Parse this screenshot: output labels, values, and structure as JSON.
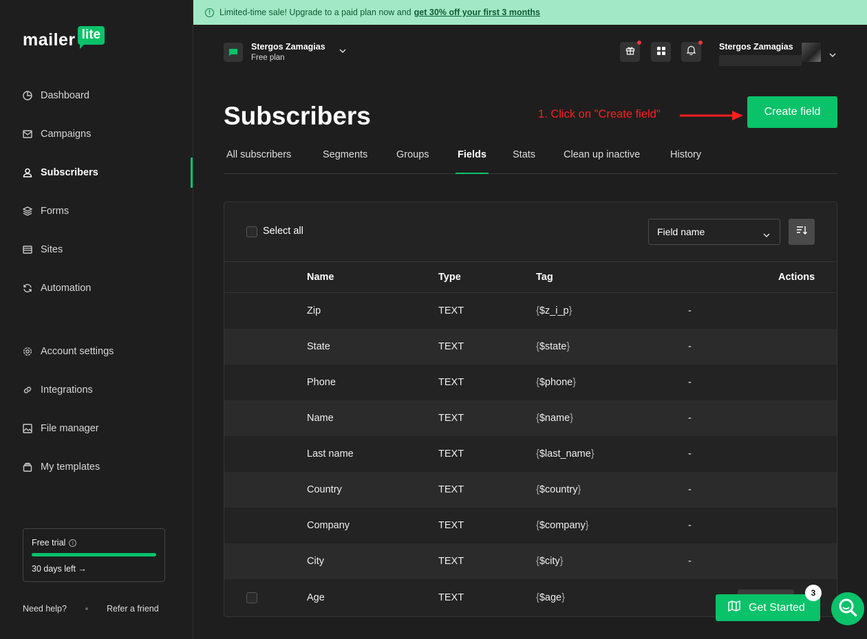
{
  "brand": {
    "word": "mailer",
    "badge": "lite",
    "accent": "#09c269"
  },
  "banner": {
    "text": "Limited-time sale! Upgrade to a paid plan now and",
    "link": "get 30% off your first 3 months"
  },
  "sidebar": {
    "items": [
      {
        "label": "Dashboard",
        "icon": "dashboard-icon"
      },
      {
        "label": "Campaigns",
        "icon": "mail-icon"
      },
      {
        "label": "Subscribers",
        "icon": "user-icon"
      },
      {
        "label": "Forms",
        "icon": "layers-icon"
      },
      {
        "label": "Sites",
        "icon": "browser-icon"
      },
      {
        "label": "Automation",
        "icon": "refresh-icon"
      },
      {
        "label": "Account settings",
        "icon": "gear-icon"
      },
      {
        "label": "Integrations",
        "icon": "link-icon"
      },
      {
        "label": "File manager",
        "icon": "image-icon"
      },
      {
        "label": "My templates",
        "icon": "template-icon"
      }
    ],
    "trial": {
      "label": "Free trial",
      "days": "30 days left →",
      "progress": 1.0
    },
    "footer": {
      "help": "Need help?",
      "refer": "Refer a friend"
    }
  },
  "header": {
    "account_name": "Stergos Zamagias",
    "account_plan": "Free plan",
    "user_name": "Stergos Zamagias"
  },
  "page": {
    "title": "Subscribers",
    "annotation": "1. Click on \"Create field\"",
    "create_button": "Create field"
  },
  "tabs": [
    {
      "label": "All subscribers"
    },
    {
      "label": "Segments"
    },
    {
      "label": "Groups"
    },
    {
      "label": "Fields",
      "active": true
    },
    {
      "label": "Stats"
    },
    {
      "label": "Clean up inactive"
    },
    {
      "label": "History"
    }
  ],
  "table": {
    "select_all": "Select all",
    "sort_select": "Field name",
    "headers": {
      "name": "Name",
      "type": "Type",
      "tag": "Tag",
      "actions": "Actions"
    },
    "rows": [
      {
        "name": "Zip",
        "type": "TEXT",
        "tag": "$z_i_p",
        "action": "-"
      },
      {
        "name": "State",
        "type": "TEXT",
        "tag": "$state",
        "action": "-"
      },
      {
        "name": "Phone",
        "type": "TEXT",
        "tag": "$phone",
        "action": "-"
      },
      {
        "name": "Name",
        "type": "TEXT",
        "tag": "$name",
        "action": "-"
      },
      {
        "name": "Last name",
        "type": "TEXT",
        "tag": "$last_name",
        "action": "-"
      },
      {
        "name": "Country",
        "type": "TEXT",
        "tag": "$country",
        "action": "-"
      },
      {
        "name": "Company",
        "type": "TEXT",
        "tag": "$company",
        "action": "-"
      },
      {
        "name": "City",
        "type": "TEXT",
        "tag": "$city",
        "action": "-"
      },
      {
        "name": "Age",
        "type": "TEXT",
        "tag": "$age",
        "action": ""
      }
    ]
  },
  "floating": {
    "get_started": "Get Started",
    "badge": "3"
  }
}
